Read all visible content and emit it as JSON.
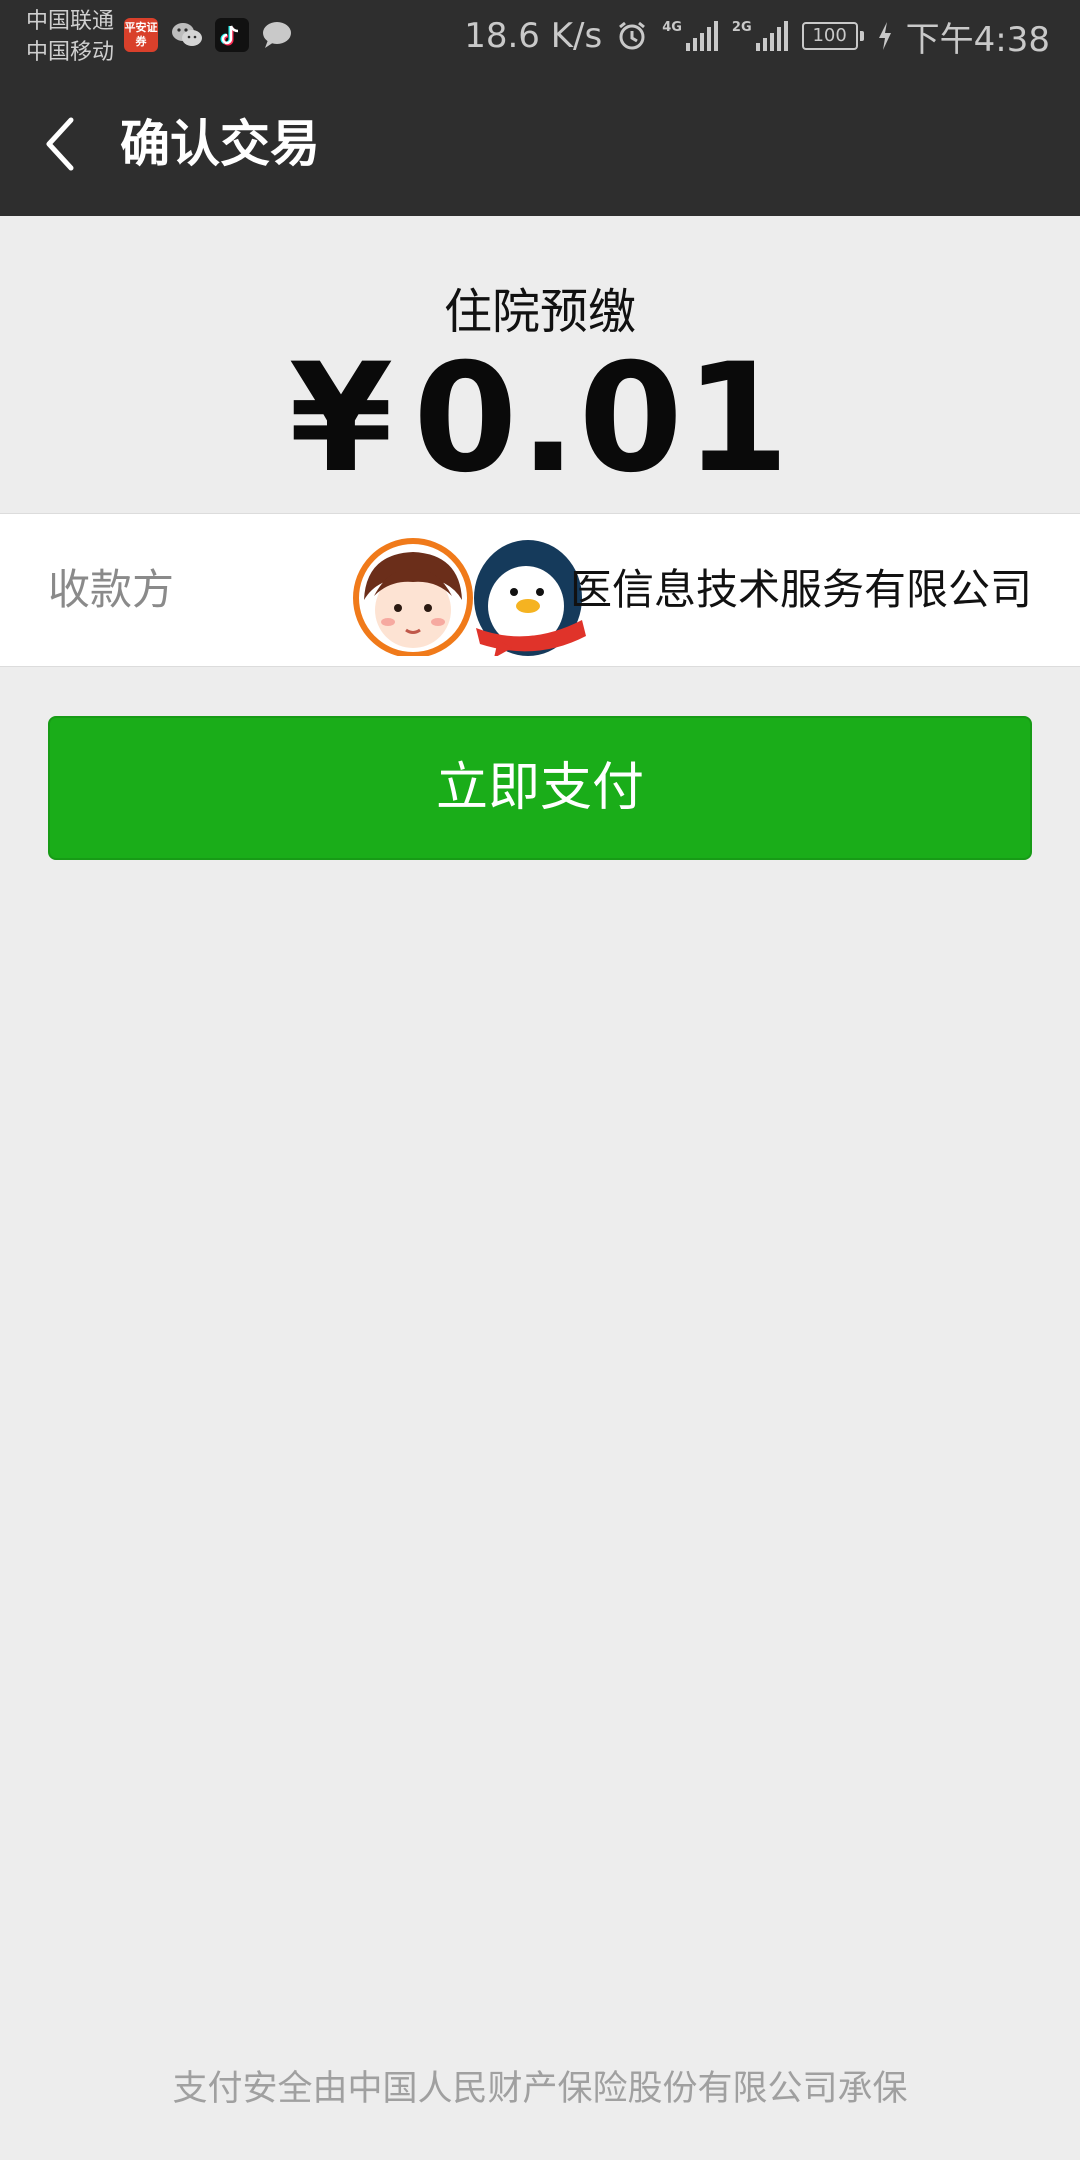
{
  "status_bar": {
    "carrier_1": "中国联通",
    "carrier_2": "中国移动",
    "pingan_icon_text": "平安证券",
    "net_speed": "18.6 K/s",
    "network_1": "4G",
    "network_2": "2G",
    "battery": "100",
    "time": "下午4:38"
  },
  "nav": {
    "title": "确认交易"
  },
  "payment": {
    "title": "住院预缴",
    "currency_symbol": "¥",
    "amount": "0.01"
  },
  "payee": {
    "label": "收款方",
    "name_visible": "医信息技术服务有限公司"
  },
  "actions": {
    "pay_label": "立即支付"
  },
  "footer": {
    "note": "支付安全由中国人民财产保险股份有限公司承保"
  },
  "colors": {
    "header_bg": "#2e2e2e",
    "page_bg": "#ededed",
    "pay_button": "#1aad19"
  }
}
